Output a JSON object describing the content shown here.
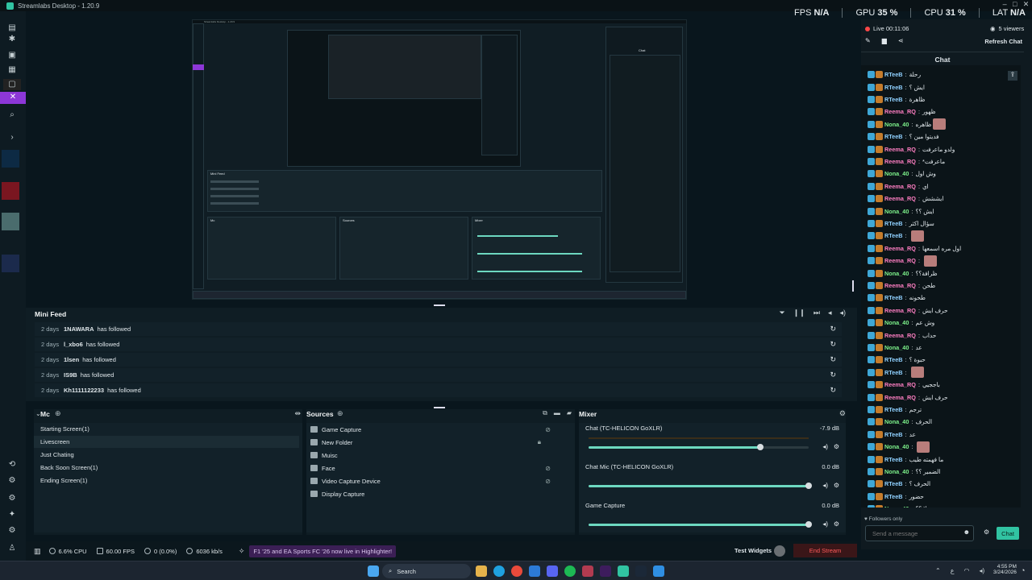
{
  "window": {
    "title": "Streamlabs Desktop - 1.20.9"
  },
  "perf": {
    "fps_label": "FPS",
    "fps_value": "N/A",
    "gpu_label": "GPU",
    "gpu_value": "35 %",
    "cpu_label": "CPU",
    "cpu_value": "31 %",
    "lat_label": "LAT",
    "lat_value": "N/A"
  },
  "chat_header": {
    "live": "Live 00:11:06",
    "viewers": "5 viewers",
    "refresh": "Refresh Chat",
    "title": "Chat",
    "followers_only": "Followers only",
    "send_placeholder": "Send a message",
    "chat_button": "Chat"
  },
  "chat_messages": [
    {
      "user": "RTeeB",
      "text": "رحلة",
      "color": "#8fd0ff"
    },
    {
      "user": "RTeeB",
      "text": "ايش ؟",
      "color": "#8fd0ff"
    },
    {
      "user": "RTeeB",
      "text": "ظاهرة",
      "color": "#8fd0ff"
    },
    {
      "user": "Reema_RQ",
      "text": "ظهور",
      "color": "#ff7fc3"
    },
    {
      "user": "Nona_40",
      "text": "ظاهره",
      "color": "#7cf08a",
      "emote": true
    },
    {
      "user": "RTeeB",
      "text": "فديتوا مين ؟",
      "color": "#8fd0ff"
    },
    {
      "user": "Reema_RQ",
      "text": "ولدو ماعرفت",
      "color": "#ff7fc3"
    },
    {
      "user": "Reema_RQ",
      "text": "*ماعرفت",
      "color": "#ff7fc3"
    },
    {
      "user": "Nona_40",
      "text": "وش اول",
      "color": "#7cf08a"
    },
    {
      "user": "Reema_RQ",
      "text": "اي",
      "color": "#ff7fc3"
    },
    {
      "user": "Reema_RQ",
      "text": "ايششش",
      "color": "#ff7fc3"
    },
    {
      "user": "Nona_40",
      "text": "ايش ؟؟",
      "color": "#7cf08a"
    },
    {
      "user": "RTeeB",
      "text": "سؤال اكثر",
      "color": "#8fd0ff"
    },
    {
      "user": "RTeeB",
      "text": "",
      "color": "#8fd0ff",
      "emote": true
    },
    {
      "user": "Reema_RQ",
      "text": "اول مره اسمعها",
      "color": "#ff7fc3"
    },
    {
      "user": "Reema_RQ",
      "text": "",
      "color": "#ff7fc3",
      "emote": true
    },
    {
      "user": "Nona_40",
      "text": "ظرافة؟؟",
      "color": "#7cf08a"
    },
    {
      "user": "Reema_RQ",
      "text": "طحن",
      "color": "#ff7fc3"
    },
    {
      "user": "RTeeB",
      "text": "طحونه",
      "color": "#8fd0ff"
    },
    {
      "user": "Reema_RQ",
      "text": "حرف ايش",
      "color": "#ff7fc3"
    },
    {
      "user": "Nona_40",
      "text": "وش عم",
      "color": "#7cf08a"
    },
    {
      "user": "Reema_RQ",
      "text": "حداب",
      "color": "#ff7fc3"
    },
    {
      "user": "Nona_40",
      "text": "عد",
      "color": "#7cf08a"
    },
    {
      "user": "RTeeB",
      "text": "حبوة ؟",
      "color": "#8fd0ff"
    },
    {
      "user": "RTeeB",
      "text": "",
      "color": "#8fd0ff",
      "emote": true
    },
    {
      "user": "Reema_RQ",
      "text": "باججيي",
      "color": "#ff7fc3"
    },
    {
      "user": "Reema_RQ",
      "text": "حرف ايش",
      "color": "#ff7fc3"
    },
    {
      "user": "RTeeB",
      "text": "ترجم",
      "color": "#8fd0ff"
    },
    {
      "user": "Nona_40",
      "text": "الحرف",
      "color": "#7cf08a"
    },
    {
      "user": "RTeeB",
      "text": "عد",
      "color": "#8fd0ff"
    },
    {
      "user": "Nona_40",
      "text": "",
      "color": "#7cf08a",
      "emote": true
    },
    {
      "user": "RTeeB",
      "text": "ما فهمته طيب",
      "color": "#8fd0ff"
    },
    {
      "user": "Nona_40",
      "text": "الضمير ؟؟",
      "color": "#7cf08a"
    },
    {
      "user": "RTeeB",
      "text": "الحرف ؟",
      "color": "#8fd0ff"
    },
    {
      "user": "RTeeB",
      "text": "حضور",
      "color": "#8fd0ff"
    },
    {
      "user": "Nona_40",
      "text": "صح ولا ؟؟",
      "color": "#7cf08a"
    }
  ],
  "minifeed": {
    "title": "Mini Feed",
    "events": [
      {
        "time": "2 days",
        "user": "1NAWARA",
        "action": "has followed"
      },
      {
        "time": "2 days",
        "user": "l_xbo6",
        "action": "has followed"
      },
      {
        "time": "2 days",
        "user": "1lsen",
        "action": "has followed"
      },
      {
        "time": "2 days",
        "user": "IS9B",
        "action": "has followed"
      },
      {
        "time": "2 days",
        "user": "Kh1111122233",
        "action": "has followed"
      }
    ]
  },
  "scenes": {
    "title": "Mc",
    "items": [
      "Starting Screen(1)",
      "Livescreen",
      "Just Chating",
      "Back Soon Screen(1)",
      "Ending Screen(1)"
    ]
  },
  "sources": {
    "title": "Sources",
    "items": [
      "Game Capture",
      "New Folder",
      "Muisc",
      "Face",
      "Video Capture Device",
      "Display Capture"
    ]
  },
  "mixer": {
    "title": "Mixer",
    "channels": [
      {
        "name": "Chat (TC-HELICON GoXLR)",
        "db": "-7.9 dB",
        "level": 0.78
      },
      {
        "name": "Chat Mic (TC-HELICON GoXLR)",
        "db": "0.0 dB",
        "level": 1.0
      },
      {
        "name": "Game Capture",
        "db": "0.0 dB",
        "level": 1.0
      }
    ]
  },
  "footer": {
    "cpu": "6.6% CPU",
    "fps": "60.00 FPS",
    "dropped": "0 (0.0%)",
    "bitrate": "6036 kb/s",
    "highlight": "F1 '25 and EA Sports FC '26 now live in Highlighter!",
    "test_widgets": "Test Widgets",
    "end_stream": "End Stream"
  },
  "taskbar": {
    "search": "Search",
    "time": "4:55 PM",
    "date": "3/24/2026"
  },
  "preview_mini": {
    "title": "Streamlabs Desktop - 1.20.9",
    "minifeed": "Mini Feed",
    "chat": "Chat",
    "scenes": "Mc",
    "sources": "Sources",
    "mixer": "Mixer"
  }
}
